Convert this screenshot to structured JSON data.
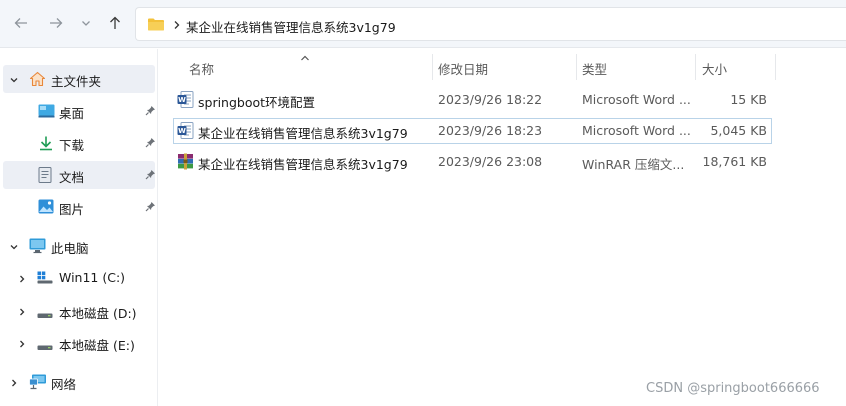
{
  "toolbar": {
    "back_icon": "arrow-left-icon",
    "forward_icon": "arrow-right-icon",
    "recent_icon": "chevron-down-icon",
    "up_icon": "arrow-up-icon"
  },
  "address": {
    "folder_icon": "folder-icon",
    "path": "某企业在线销售管理信息系统3v1g79"
  },
  "sidebar": {
    "home": {
      "label": "主文件夹",
      "icon": "home-icon"
    },
    "quick": [
      {
        "label": "桌面",
        "icon": "desktop-icon"
      },
      {
        "label": "下载",
        "icon": "download-icon"
      },
      {
        "label": "文档",
        "icon": "document-icon"
      },
      {
        "label": "图片",
        "icon": "picture-icon"
      }
    ],
    "this_pc": {
      "label": "此电脑",
      "icon": "monitor-icon"
    },
    "drives": [
      {
        "label": "Win11 (C:)",
        "icon": "windows-drive-icon"
      },
      {
        "label": "本地磁盘 (D:)",
        "icon": "disk-drive-icon"
      },
      {
        "label": "本地磁盘 (E:)",
        "icon": "disk-drive-icon"
      }
    ],
    "network": {
      "label": "网络",
      "icon": "network-icon"
    }
  },
  "columns": {
    "name": "名称",
    "modified": "修改日期",
    "type": "类型",
    "size": "大小"
  },
  "files": [
    {
      "name": "springboot环境配置",
      "modified": "2023/9/26 18:22",
      "type": "Microsoft Word ...",
      "size": "15 KB",
      "icon": "word-doc-icon"
    },
    {
      "name": "某企业在线销售管理信息系统3v1g79",
      "modified": "2023/9/26 18:23",
      "type": "Microsoft Word ...",
      "size": "5,045 KB",
      "icon": "word-doc-icon"
    },
    {
      "name": "某企业在线销售管理信息系统3v1g79",
      "modified": "2023/9/26 23:08",
      "type": "WinRAR 压缩文...",
      "size": "18,761 KB",
      "icon": "winrar-archive-icon"
    }
  ],
  "watermark": "CSDN @springboot666666",
  "colors": {
    "selection_bg": "#eceff5",
    "selection_border": "#b9d3e8",
    "folder_yellow": "#f3c13a",
    "word_blue": "#2b5797"
  }
}
